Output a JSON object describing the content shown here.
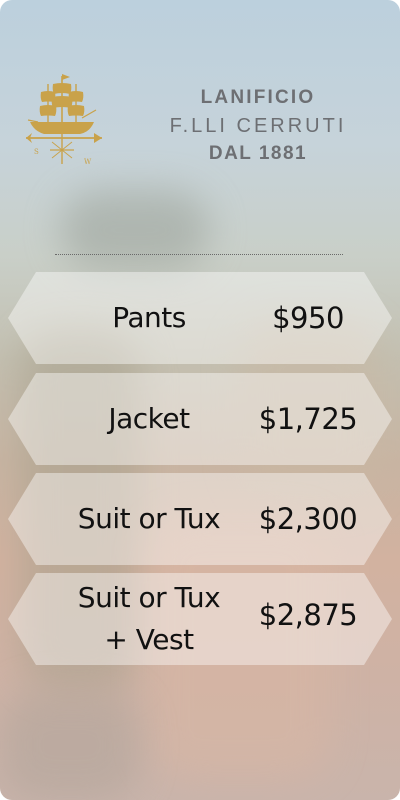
{
  "brand": {
    "line1": "LANIFICIO",
    "line2": "F.LLI CERRUTI",
    "line3": "DAL 1881",
    "text_color": "#6d6f73",
    "logo_color": "#c9a24a",
    "logo_icon": "ship-weathervane-icon"
  },
  "prices": [
    {
      "name": "Pants",
      "price": "$950"
    },
    {
      "name": "Jacket",
      "price": "$1,725"
    },
    {
      "name": "Suit or Tux",
      "price": "$2,300"
    },
    {
      "name_line1": "Suit or Tux",
      "name_line2": "+ Vest",
      "price": "$2,875"
    }
  ],
  "colors": {
    "row_background": "rgba(255,255,255,0.42)",
    "text": "#111111"
  }
}
